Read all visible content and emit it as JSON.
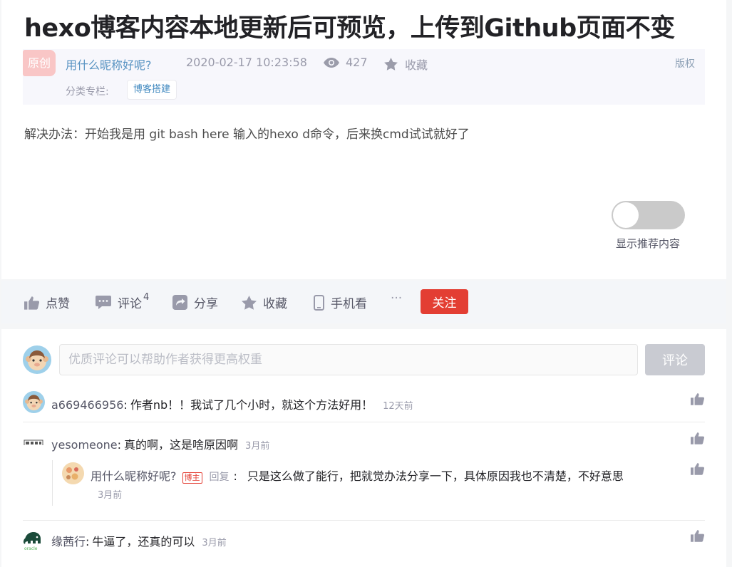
{
  "article": {
    "title": "hexo博客内容本地更新后可预览，上传到Github页面不变",
    "badge": "原创",
    "author": "用什么昵称好呢?",
    "date": "2020-02-17 10:23:58",
    "views": "427",
    "favorite_label": "收藏",
    "copyright_label": "版权",
    "category_label": "分类专栏:",
    "category_tag": "博客搭建",
    "content": "解决办法：开始我是用 git bash here 输入的hexo d命令，后来换cmd试试就好了",
    "recommend_toggle_label": "显示推荐内容"
  },
  "toolbar": {
    "like": "点赞",
    "comment": "评论",
    "comment_count": "4",
    "share": "分享",
    "favorite": "收藏",
    "mobile": "手机看",
    "more": "···",
    "follow": "关注"
  },
  "comment_box": {
    "placeholder": "优质评论可以帮助作者获得更高权重",
    "submit": "评论"
  },
  "comments": [
    {
      "user": "a669466956",
      "text": "作者nb！！我试了几个小时，就这个方法好用！",
      "time": "12天前"
    },
    {
      "user": "yesomeone",
      "text": "真的啊，这是啥原因啊",
      "time": "3月前",
      "reply": {
        "user": "用什么昵称好呢?",
        "badge": "博主",
        "reply_label": "回复",
        "text": "只是这么做了能行，把就觉办法分享一下，具体原因我也不清楚，不好意思",
        "time": "3月前"
      }
    },
    {
      "user": "缘茜行",
      "text": "牛逼了，还真的可以",
      "time": "3月前"
    }
  ],
  "colors": {
    "accent_red": "#e33e33",
    "link_blue": "#5893c2"
  }
}
